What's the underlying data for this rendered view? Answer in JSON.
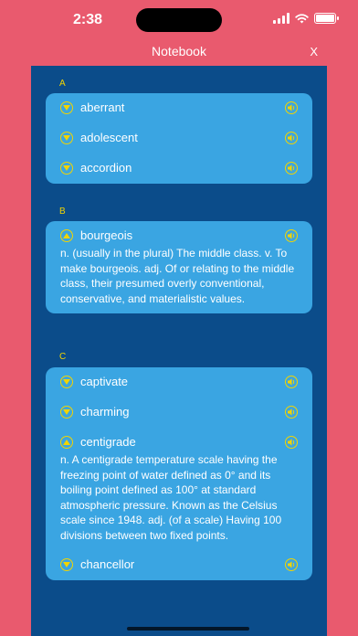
{
  "status": {
    "time": "2:38"
  },
  "nav": {
    "title": "Notebook",
    "close_label": "X"
  },
  "sections": [
    {
      "letter": "A",
      "entries": [
        {
          "word": "aberrant",
          "expanded": false
        },
        {
          "word": "adolescent",
          "expanded": false
        },
        {
          "word": "accordion",
          "expanded": false
        }
      ]
    },
    {
      "letter": "B",
      "entries": [
        {
          "word": "bourgeois",
          "expanded": true,
          "definition": "n. (usually in the plural) The middle class. v. To make bourgeois. adj. Of or relating to the middle class, their presumed overly conventional, conservative, and materialistic values."
        }
      ]
    },
    {
      "letter": "C",
      "entries": [
        {
          "word": "captivate",
          "expanded": false
        },
        {
          "word": "charming",
          "expanded": false
        },
        {
          "word": "centigrade",
          "expanded": true,
          "definition": "n. A centigrade temperature scale having the freezing point of water defined as 0° and its boiling point defined as 100° at standard atmospheric pressure. Known as the Celsius scale since 1948. adj. (of a scale) Having 100 divisions between two fixed points."
        },
        {
          "word": "chancellor",
          "expanded": false
        }
      ]
    }
  ],
  "colors": {
    "header": "#e95a6e",
    "background": "#0b4c8a",
    "card": "#3aa5e2",
    "accent": "#f2d400"
  },
  "icons": {
    "expand": "chevron-down-icon",
    "collapse": "chevron-up-icon",
    "audio": "speaker-icon"
  }
}
